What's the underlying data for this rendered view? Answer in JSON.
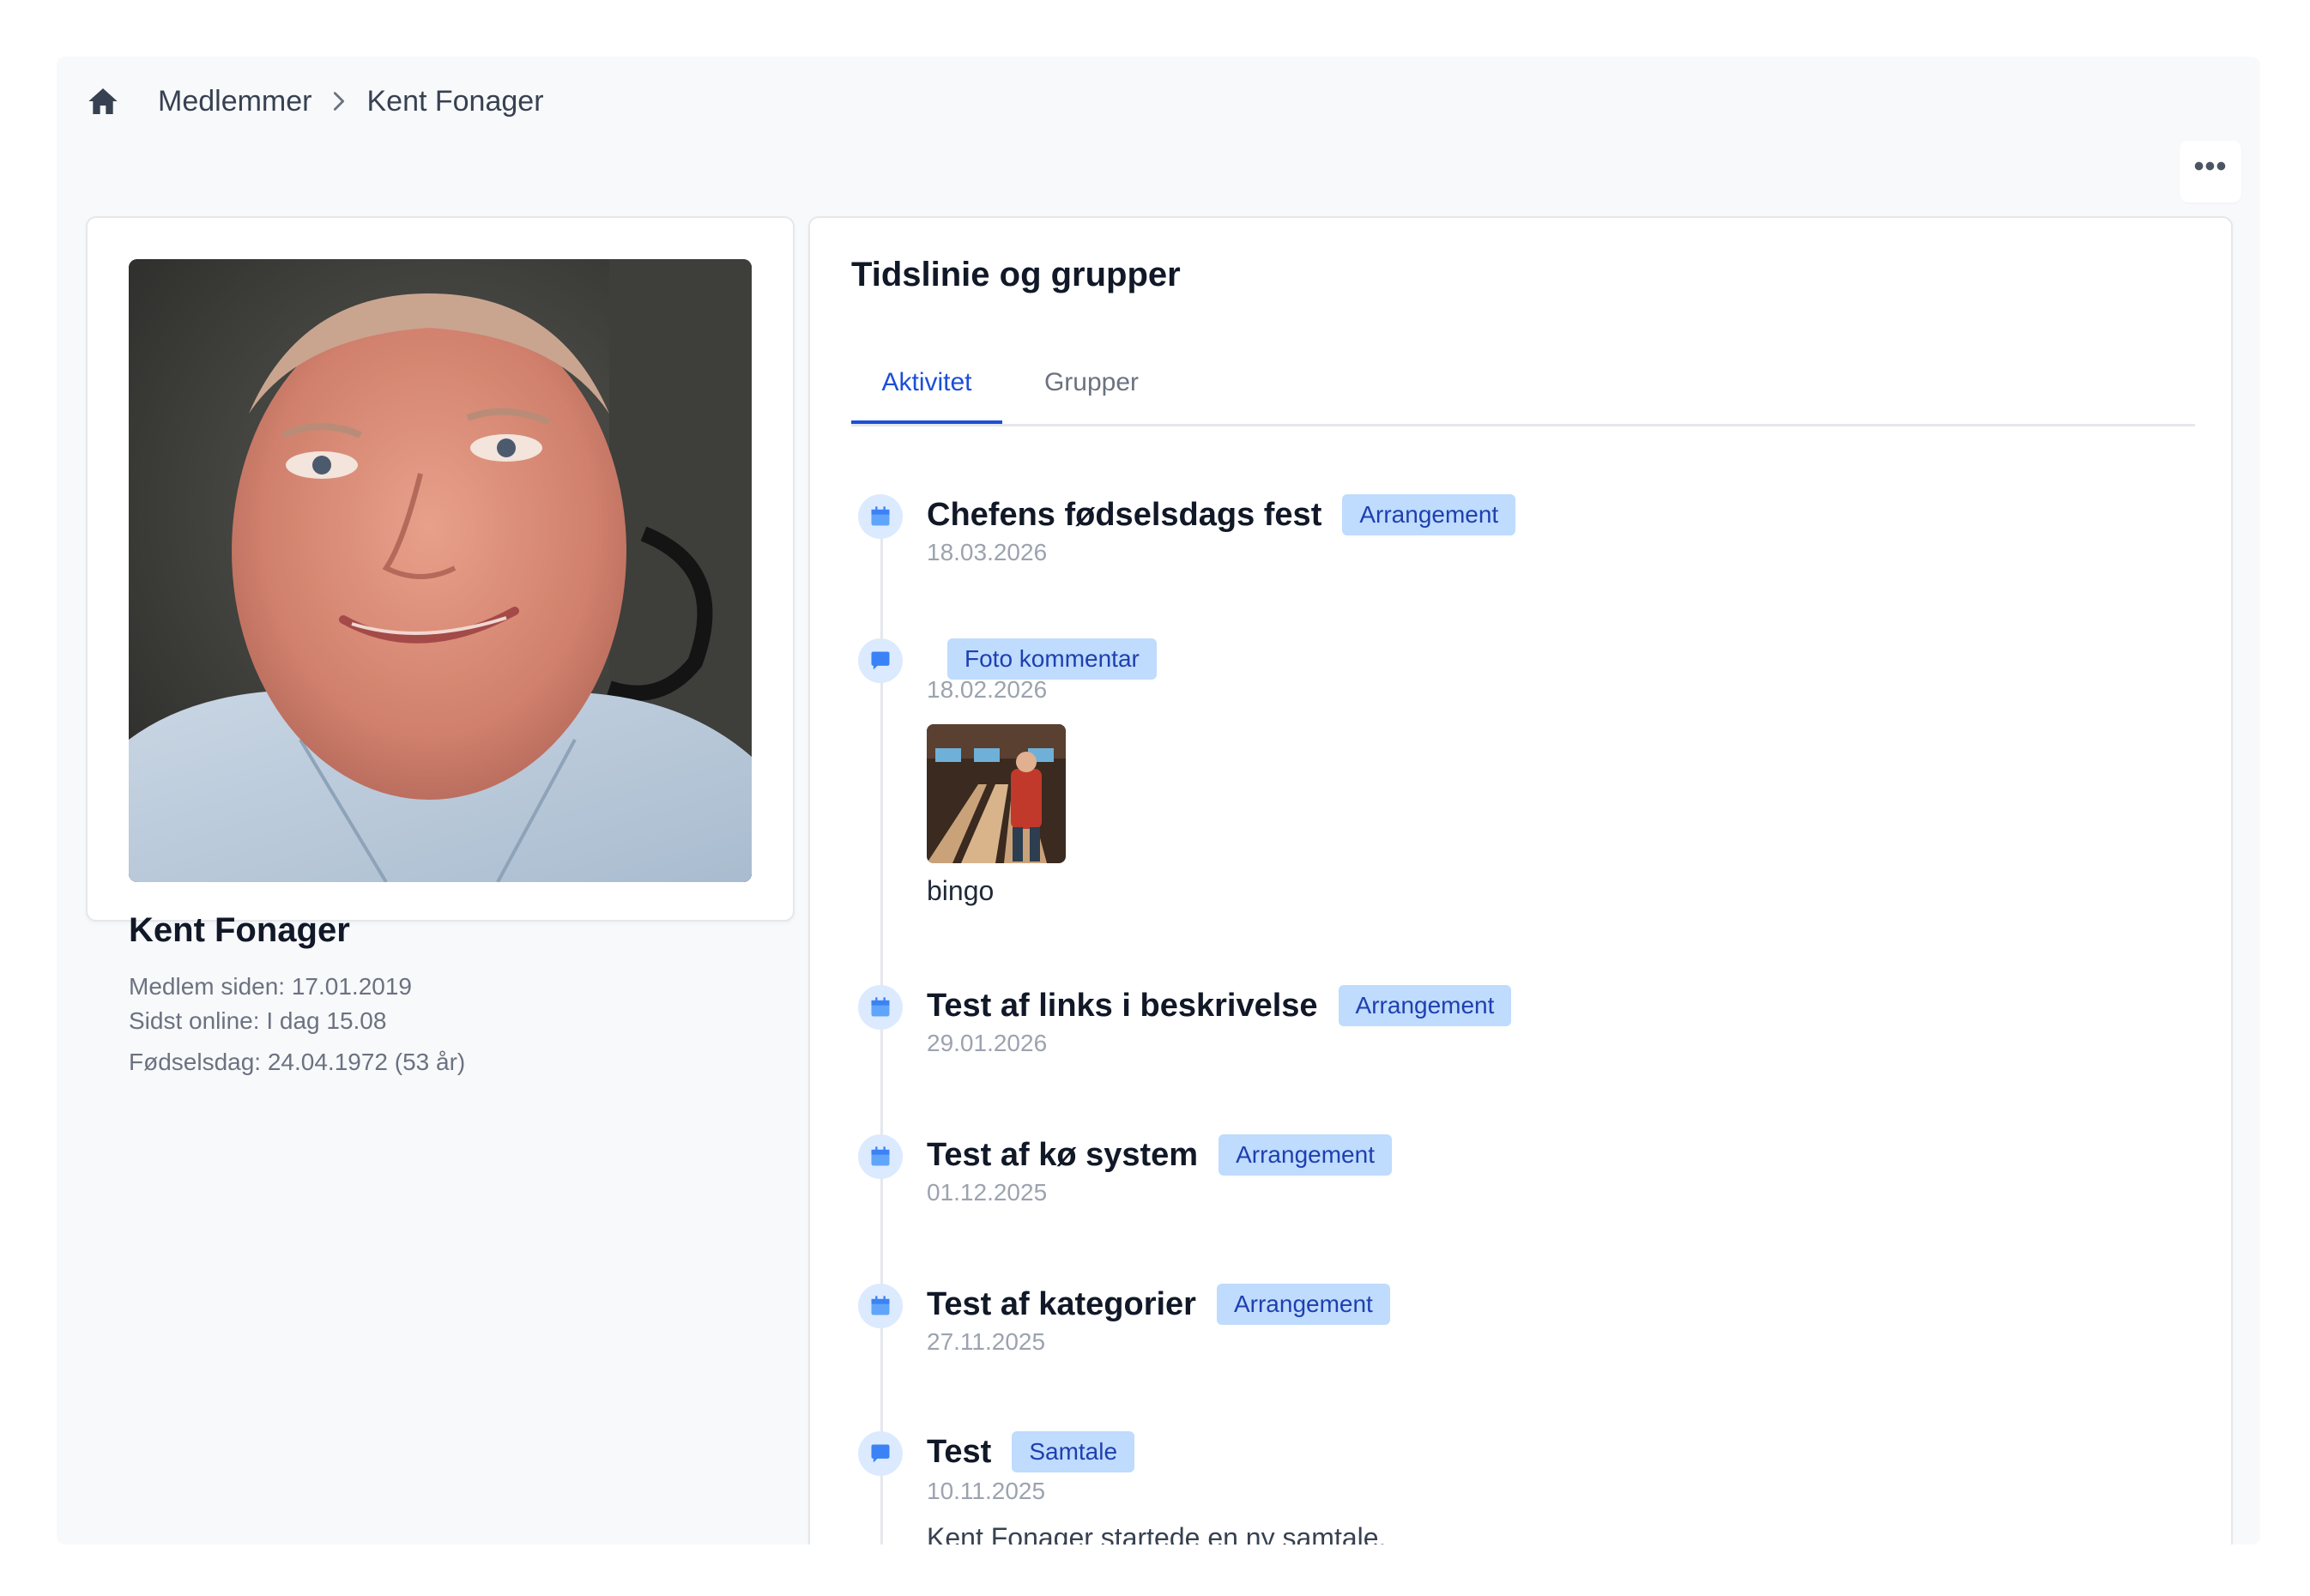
{
  "breadcrumb": {
    "home_icon": "home-icon",
    "items": [
      "Medlemmer",
      "Kent Fonager"
    ]
  },
  "actions": {
    "more_icon": "more-horizontal-icon",
    "more_label": "•••"
  },
  "profile": {
    "name": "Kent Fonager",
    "member_since": "Medlem siden: 17.01.2019",
    "last_online": "Sidst online: I dag 15.08",
    "birthday": "Fødselsdag: 24.04.1972 (53 år)"
  },
  "timeline_card": {
    "title": "Tidslinie og grupper",
    "tabs": [
      {
        "label": "Aktivitet",
        "active": true
      },
      {
        "label": "Grupper",
        "active": false
      }
    ],
    "items": [
      {
        "icon": "calendar-icon",
        "title": "Chefens fødselsdags fest",
        "badge": "Arrangement",
        "date": "18.03.2026"
      },
      {
        "icon": "chat-bubble-icon",
        "title": "",
        "badge": "Foto kommentar",
        "date": "18.02.2026",
        "caption": "bingo"
      },
      {
        "icon": "calendar-icon",
        "title": "Test af links i beskrivelse",
        "badge": "Arrangement",
        "date": "29.01.2026"
      },
      {
        "icon": "calendar-icon",
        "title": "Test af kø system",
        "badge": "Arrangement",
        "date": "01.12.2025"
      },
      {
        "icon": "calendar-icon",
        "title": "Test af kategorier",
        "badge": "Arrangement",
        "date": "27.11.2025"
      },
      {
        "icon": "chat-bubble-icon",
        "title": "Test",
        "badge": "Samtale",
        "date": "10.11.2025",
        "body": "Kent Fonager startede en ny samtale."
      }
    ]
  },
  "colors": {
    "accent": "#1d4ed8",
    "badge_bg": "#bfdbfe",
    "badge_text": "#1e40af",
    "page_bg": "#f8f9fb"
  }
}
